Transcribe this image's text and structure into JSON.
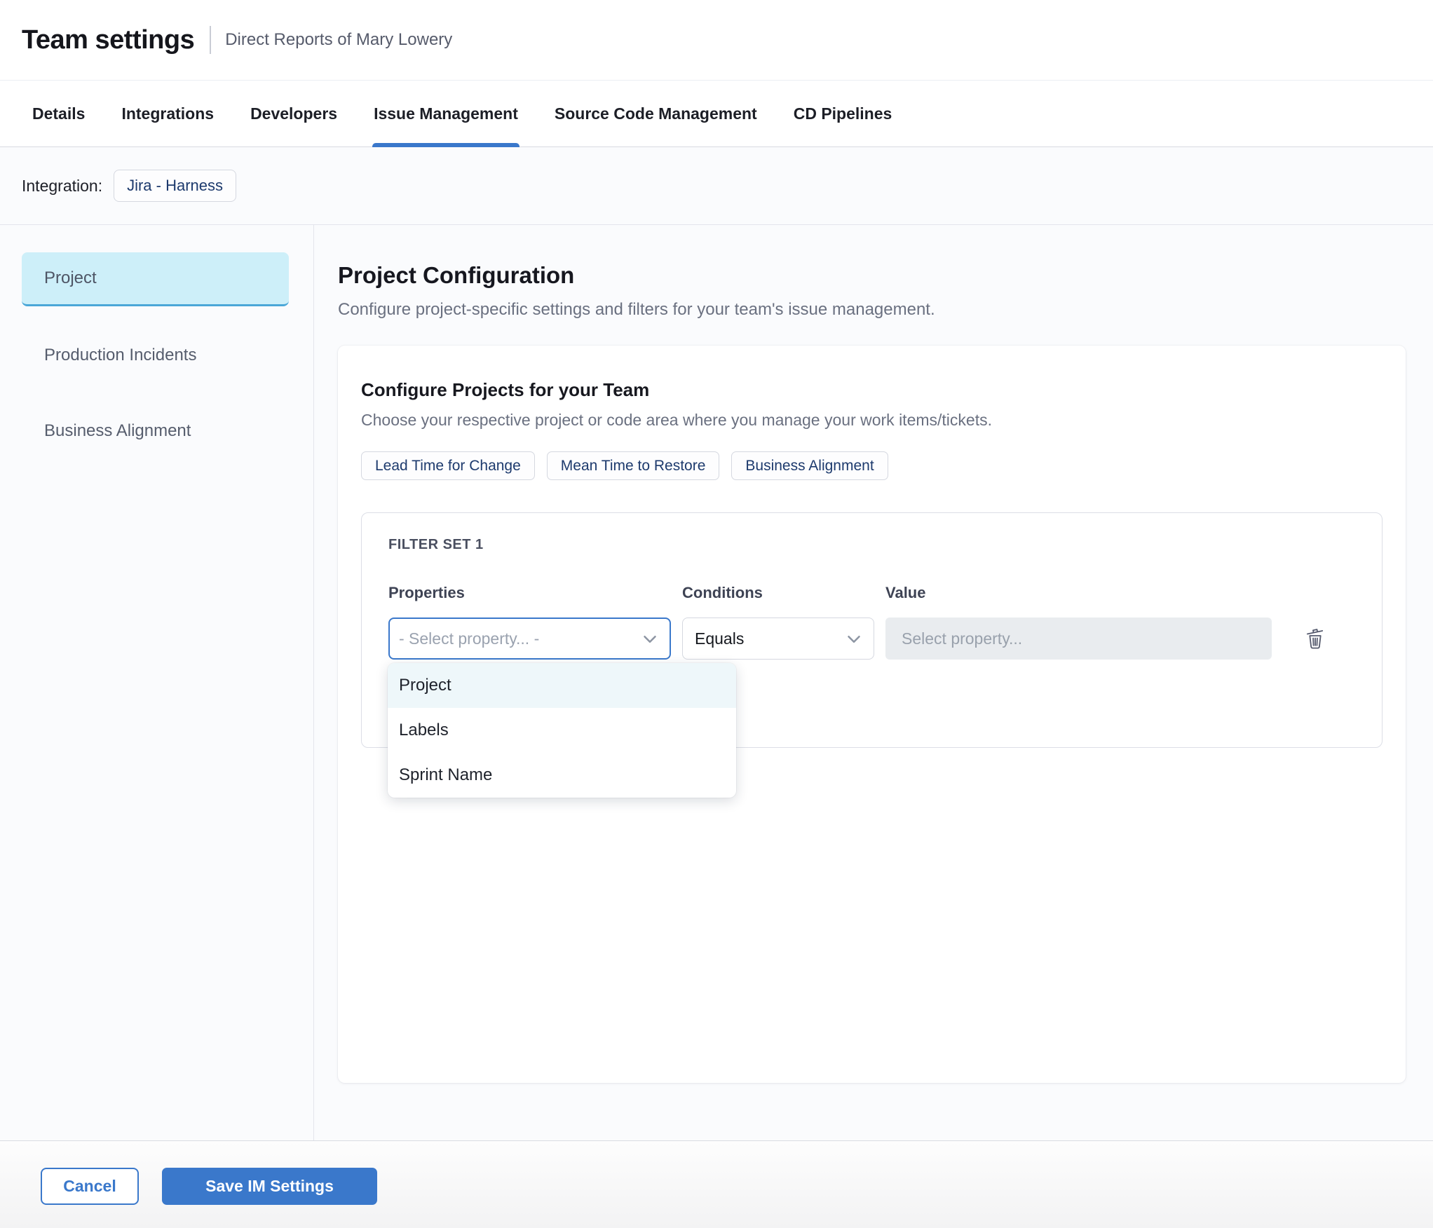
{
  "header": {
    "title": "Team settings",
    "subtitle": "Direct Reports of Mary Lowery"
  },
  "tabs": {
    "items": [
      {
        "label": "Details"
      },
      {
        "label": "Integrations"
      },
      {
        "label": "Developers"
      },
      {
        "label": "Issue Management",
        "active": true
      },
      {
        "label": "Source Code Management"
      },
      {
        "label": "CD Pipelines"
      }
    ]
  },
  "integration": {
    "label": "Integration:",
    "chip": "Jira - Harness"
  },
  "sidebar": {
    "items": [
      {
        "label": "Project",
        "selected": true
      },
      {
        "label": "Production Incidents"
      },
      {
        "label": "Business Alignment"
      }
    ]
  },
  "main": {
    "heading": "Project Configuration",
    "subheading": "Configure project-specific settings and filters for your team's issue management.",
    "card": {
      "title": "Configure Projects for your Team",
      "subtitle": "Choose your respective project or code area where you manage your work items/tickets.",
      "pills": [
        {
          "label": "Lead Time for Change"
        },
        {
          "label": "Mean Time to Restore"
        },
        {
          "label": "Business Alignment"
        }
      ],
      "filter_set": {
        "title": "FILTER SET 1",
        "columns": {
          "properties": "Properties",
          "conditions": "Conditions",
          "value": "Value"
        },
        "property_select": {
          "value": "- Select property... -"
        },
        "condition_select": {
          "value": "Equals"
        },
        "value_input": {
          "placeholder": "Select property..."
        },
        "dropdown": {
          "options": [
            {
              "label": "Project",
              "highlighted": true
            },
            {
              "label": "Labels"
            },
            {
              "label": "Sprint Name"
            }
          ]
        }
      }
    }
  },
  "footer": {
    "cancel_label": "Cancel",
    "save_label": "Save IM Settings"
  },
  "icons": {
    "trash": "trash-icon",
    "chevron": "chevron-down-icon"
  },
  "colors": {
    "accent_blue": "#3A78CB",
    "selected_nav_bg": "#CDEFF9",
    "selected_nav_border": "#4AA7D8",
    "dropdown_highlight": "#EEF7FA",
    "chip_text": "#1D3A6D",
    "content_bg": "#FAFBFD",
    "disabled_input_bg": "#E9ECEF"
  }
}
